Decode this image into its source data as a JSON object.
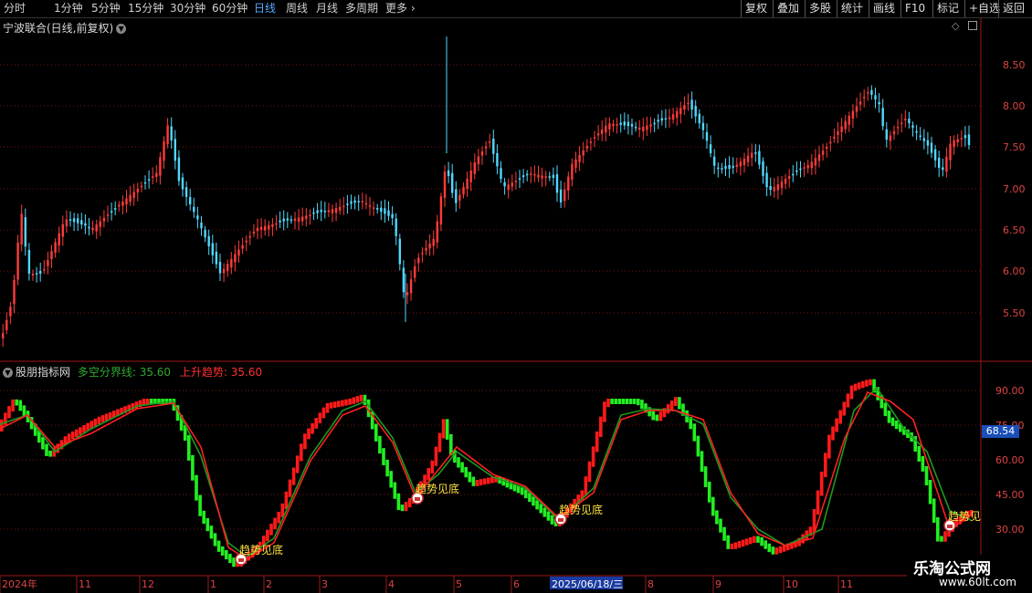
{
  "toolbar": {
    "periods": [
      "分时",
      "1分钟",
      "5分钟",
      "15分钟",
      "30分钟",
      "60分钟",
      "日线",
      "周线",
      "月线",
      "多周期",
      "更多"
    ],
    "active_period": "日线",
    "more_arrow": "›",
    "right_buttons": [
      "复权",
      "叠加",
      "多股",
      "统计",
      "画线",
      "F10",
      "标记",
      "+自选",
      "返回"
    ]
  },
  "main_panel": {
    "title": "宁波联合(日线,前复权)",
    "price_ticks": [
      "8.50",
      "8.00",
      "7.50",
      "7.00",
      "6.50",
      "6.00",
      "5.50"
    ],
    "diamond_icon": "diamond-icon",
    "layout_icon": "panel-layout-icon"
  },
  "indicator_panel": {
    "name": "股朋指标网",
    "line1_label": "多空分界线: 35.60",
    "line2_label": "上升趋势: 35.60",
    "ticks": [
      "90.00",
      "75.00",
      "60.00",
      "45.00",
      "30.00"
    ],
    "current_value": "68.54",
    "signal_text": "趋势见底",
    "signal_text_cut": "趋势见",
    "colors": {
      "up": "#ff1a1a",
      "down": "#22ee22",
      "line_green": "#1e9a1e",
      "line_red": "#ff2020"
    }
  },
  "date_axis": {
    "labels": [
      "2024年",
      "11",
      "12",
      "1",
      "2",
      "3",
      "4",
      "5",
      "6",
      "2025/06/18/三",
      "8",
      "9",
      "10",
      "11"
    ]
  },
  "watermark": {
    "line1": "乐淘公式网",
    "line2": "www.60lt.com"
  }
}
